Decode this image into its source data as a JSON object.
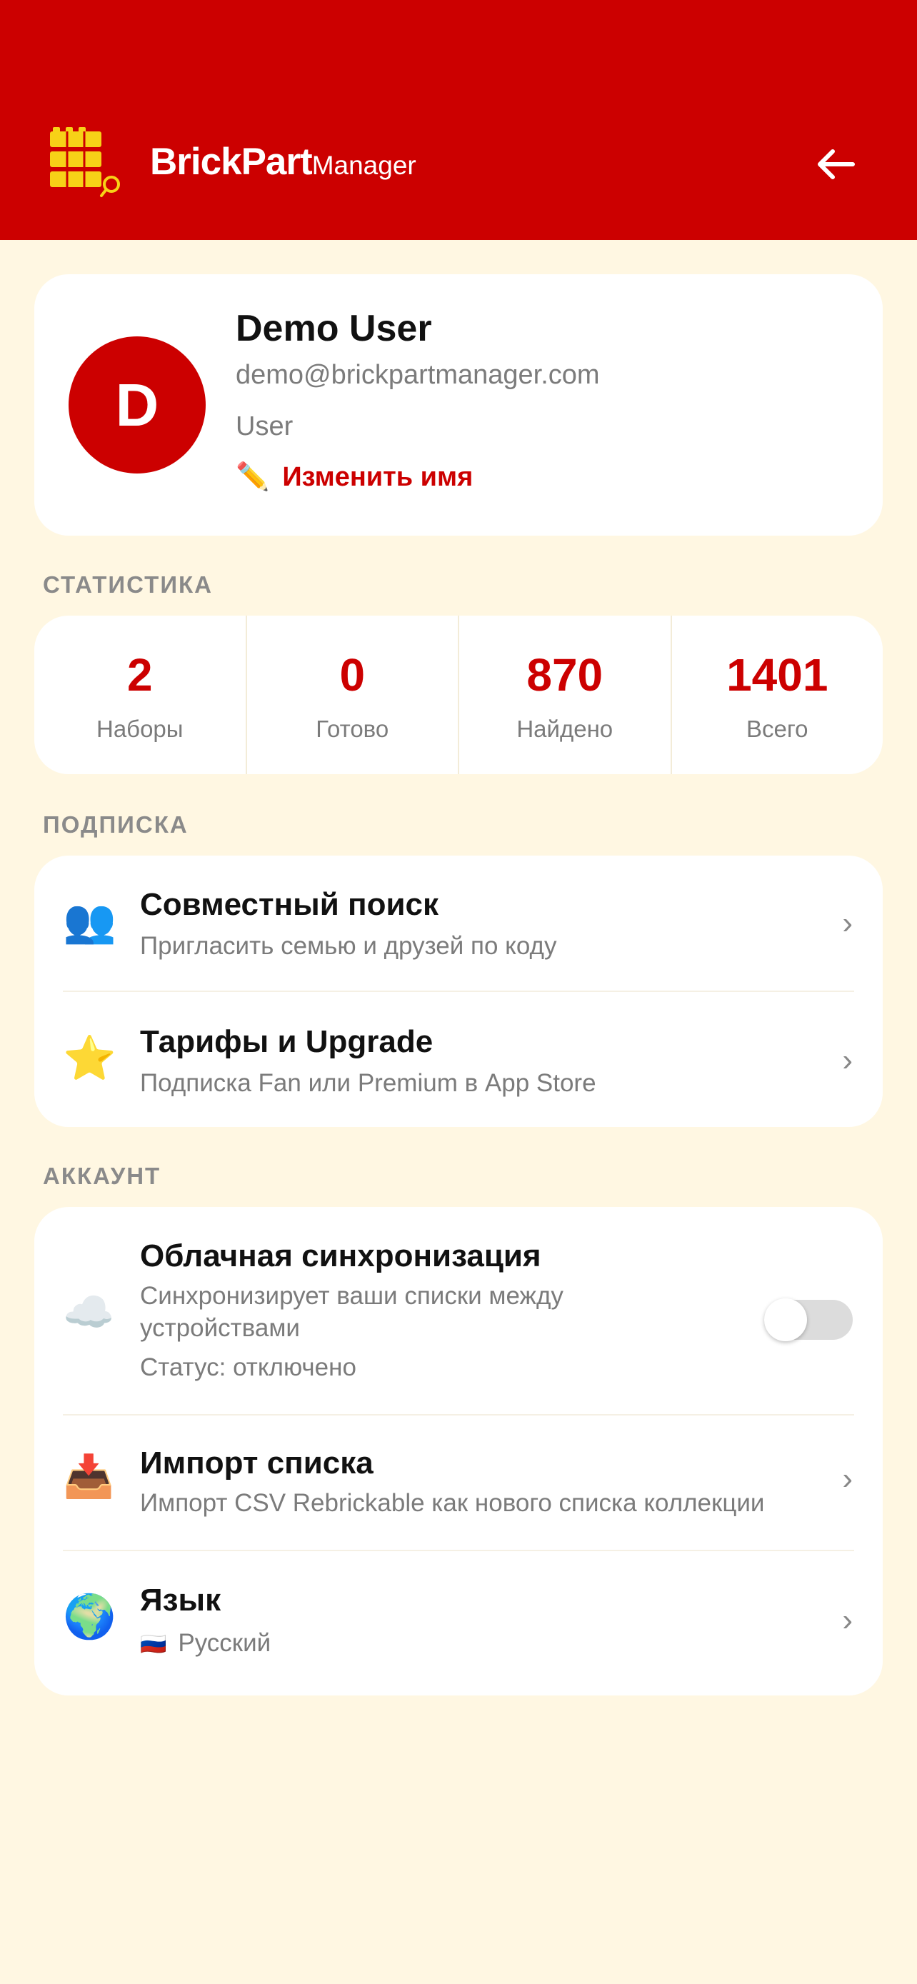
{
  "header": {
    "brand_bold": "BrickPart",
    "brand_light": "Manager",
    "back_icon": "arrow-left-icon",
    "brand_color": "#CC0000"
  },
  "profile": {
    "initial": "D",
    "name": "Demo User",
    "email": "demo@brickpartmanager.com",
    "role": "User",
    "edit_icon": "✏️",
    "edit_label": "Изменить имя"
  },
  "stats": {
    "section_title": "СТАТИСТИКА",
    "items": [
      {
        "value": "2",
        "label": "Наборы"
      },
      {
        "value": "0",
        "label": "Готово"
      },
      {
        "value": "870",
        "label": "Найдено"
      },
      {
        "value": "1401",
        "label": "Всего"
      }
    ]
  },
  "subscription": {
    "section_title": "ПОДПИСКА",
    "items": [
      {
        "icon": "👥",
        "title": "Совместный поиск",
        "subtitle": "Пригласить семью и друзей по коду"
      },
      {
        "icon": "⭐",
        "title": "Тарифы и Upgrade",
        "subtitle": "Подписка Fan или Premium в App Store"
      }
    ]
  },
  "account": {
    "section_title": "АККАУНТ",
    "sync": {
      "icon": "☁️",
      "title": "Облачная синхронизация",
      "subtitle": "Синхронизирует ваши списки между устройствами",
      "status": "Статус: отключено",
      "enabled": false
    },
    "import": {
      "icon": "📥",
      "title": "Импорт списка",
      "subtitle": "Импорт CSV Rebrickable как нового списка коллекции"
    },
    "language": {
      "icon": "🌍",
      "title": "Язык",
      "flag": "🇷🇺",
      "value": "Русский"
    }
  },
  "chevron": "›"
}
